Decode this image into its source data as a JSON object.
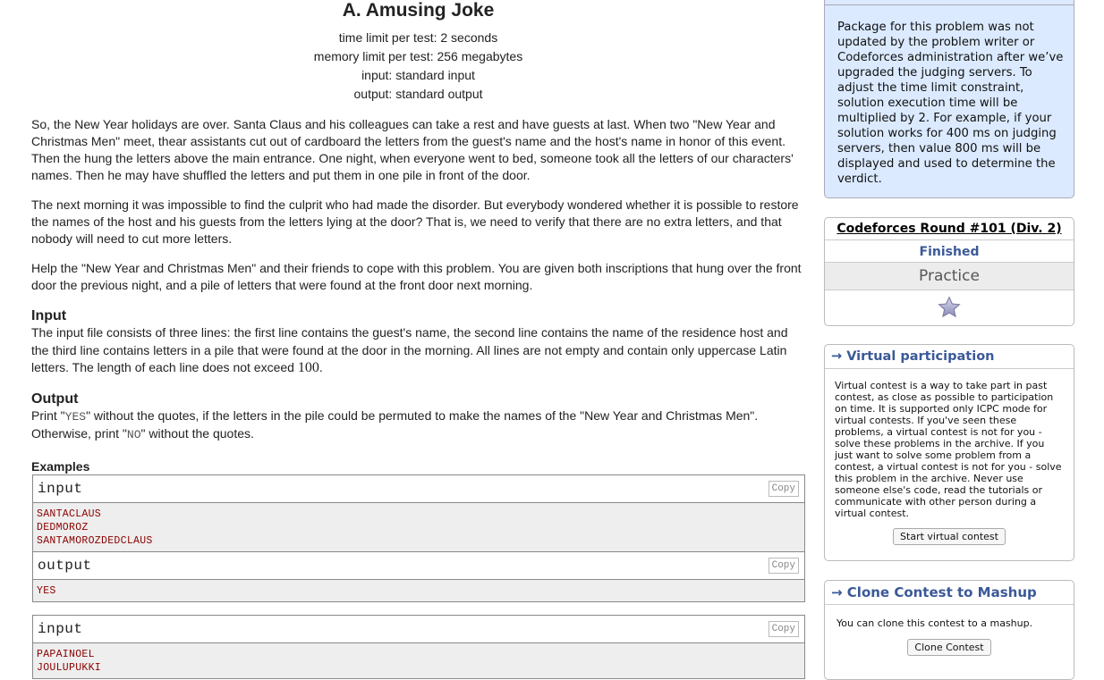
{
  "problem": {
    "title": "A. Amusing Joke",
    "limits": [
      "time limit per test: 2 seconds",
      "memory limit per test: 256 megabytes",
      "input: standard input",
      "output: standard output"
    ],
    "legend": [
      "So, the New Year holidays are over. Santa Claus and his colleagues can take a rest and have guests at last. When two \"New Year and Christmas Men\" meet, thear assistants cut out of cardboard the letters from the guest's name and the host's name in honor of this event. Then the hung the letters above the main entrance. One night, when everyone went to bed, someone took all the letters of our characters' names. Then he may have shuffled the letters and put them in one pile in front of the door.",
      "The next morning it was impossible to find the culprit who had made the disorder. But everybody wondered whether it is possible to restore the names of the host and his guests from the letters lying at the door? That is, we need to verify that there are no extra letters, and that nobody will need to cut more letters.",
      "Help the \"New Year and Christmas Men\" and their friends to cope with this problem. You are given both inscriptions that hung over the front door the previous night, and a pile of letters that were found at the front door next morning."
    ],
    "input_title": "Input",
    "input_text": "The input file consists of three lines: the first line contains the guest's name, the second line contains the name of the residence host and the third line contains letters in a pile that were found at the door in the morning. All lines are not empty and contain only uppercase Latin letters. The length of each line does not exceed ",
    "input_limit": "100",
    "input_end": ".",
    "output_title": "Output",
    "output_p1": "Print \"",
    "output_yes": "YES",
    "output_p2": "\" without the quotes, if the letters in the pile could be permuted to make the names of the \"New Year and Christmas Men\". Otherwise, print \"",
    "output_no": "NO",
    "output_p3": "\" without the quotes.",
    "examples_title": "Examples",
    "input_label": "input",
    "output_label": "output",
    "copy_label": "Copy",
    "sample1_input": [
      "SANTACLAUS",
      "DEDMOROZ",
      "SANTAMOROZDEDCLAUS"
    ],
    "sample1_output": [
      "YES"
    ],
    "sample2_input": [
      "PAPAINOEL",
      "JOULUPUKKI"
    ]
  },
  "sidebar": {
    "notice": "Package for this problem was not updated by the problem writer or Codeforces administration after we’ve upgraded the judging servers. To adjust the time limit constraint, solution execution time will be multiplied by 2. For example, if your solution works for 400 ms on judging servers, then value 800 ms will be displayed and used to determine the verdict.",
    "round_name": "Codeforces Round #101 (Div. 2)",
    "round_status": "Finished",
    "round_phase": "Practice",
    "virtual_caption": "→ Virtual participation",
    "virtual_text": "Virtual contest is a way to take part in past contest, as close as possible to participation on time. It is supported only ICPC mode for virtual contests. If you've seen these problems, a virtual contest is not for you - solve these problems in the archive. If you just want to solve some problem from a contest, a virtual contest is not for you - solve this problem in the archive. Never use someone else's code, read the tutorials or communicate with other person during a virtual contest.",
    "virtual_button": "Start virtual contest",
    "clone_caption": "→ Clone Contest to Mashup",
    "clone_text": "You can clone this contest to a mashup.",
    "clone_button": "Clone Contest"
  },
  "colors": {
    "accent": "#3b5998",
    "notice_bg": "#dbeaff",
    "sample_text": "#8b0000"
  }
}
